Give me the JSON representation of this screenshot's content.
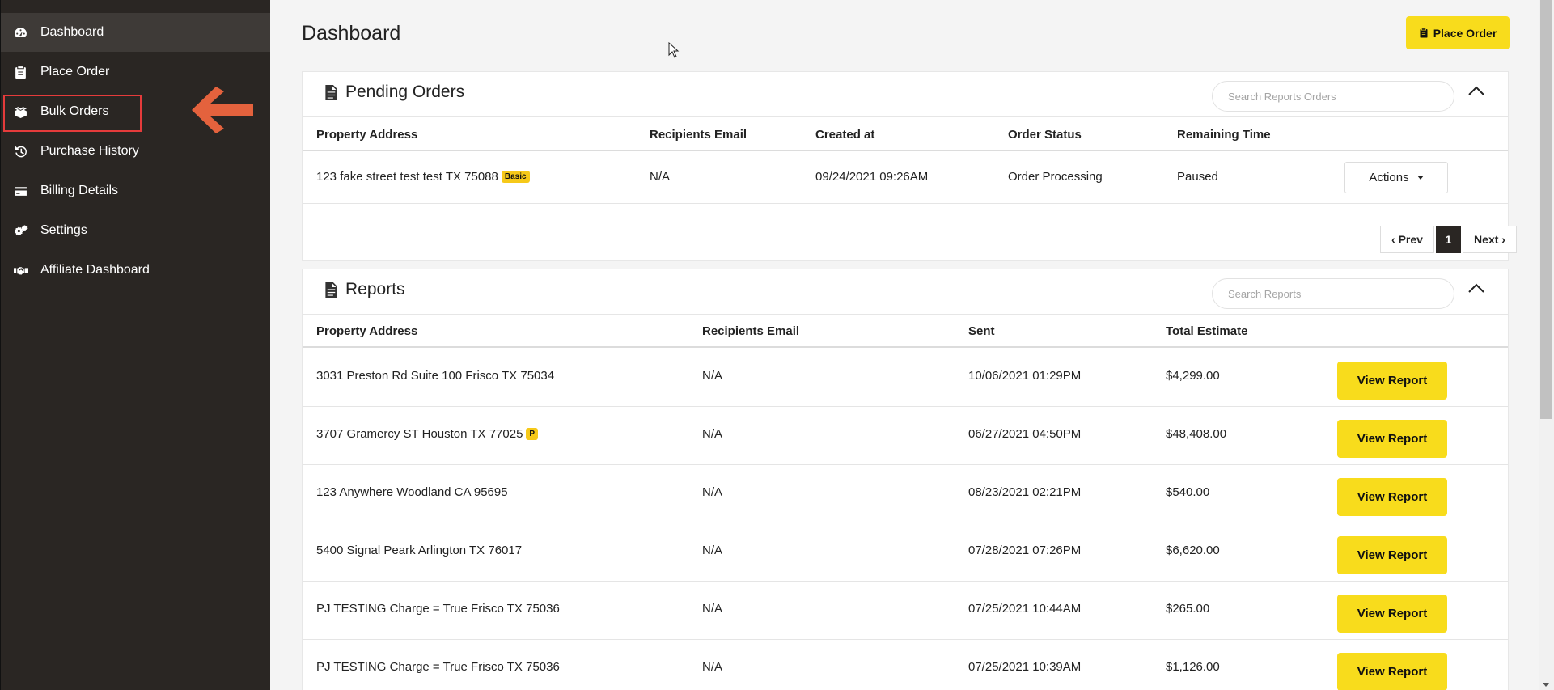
{
  "sidebar": {
    "items": [
      {
        "label": "Dashboard",
        "icon": "dashboard-icon"
      },
      {
        "label": "Place Order",
        "icon": "clipboard-icon"
      },
      {
        "label": "Bulk Orders",
        "icon": "boxes-icon"
      },
      {
        "label": "Purchase History",
        "icon": "history-icon"
      },
      {
        "label": "Billing Details",
        "icon": "credit-card-icon"
      },
      {
        "label": "Settings",
        "icon": "gears-icon"
      },
      {
        "label": "Affiliate Dashboard",
        "icon": "handshake-icon"
      }
    ],
    "active_index": 0,
    "highlight_color": "#e53b3b",
    "arrow_color": "#e4623d"
  },
  "header": {
    "title": "Dashboard",
    "place_order_label": "Place Order"
  },
  "pending": {
    "title": "Pending Orders",
    "search_placeholder": "Search Reports Orders",
    "columns": [
      "Property Address",
      "Recipients Email",
      "Created at",
      "Order Status",
      "Remaining Time"
    ],
    "rows": [
      {
        "address": "123 fake street test test TX 75088",
        "badge": "Basic",
        "email": "N/A",
        "created": "09/24/2021 09:26AM",
        "status": "Order Processing",
        "remaining": "Paused",
        "action": "Actions"
      }
    ],
    "pager": {
      "prev": "‹ Prev",
      "page": "1",
      "next": "Next ›"
    }
  },
  "reports": {
    "title": "Reports",
    "search_placeholder": "Search Reports",
    "columns": [
      "Property Address",
      "Recipients Email",
      "Sent",
      "Total Estimate"
    ],
    "button_label": "View Report",
    "rows": [
      {
        "address": "3031 Preston Rd Suite 100 Frisco TX 75034",
        "badge": "",
        "email": "N/A",
        "sent": "10/06/2021 01:29PM",
        "total": "$4,299.00"
      },
      {
        "address": "3707 Gramercy ST Houston TX 77025",
        "badge": "P",
        "email": "N/A",
        "sent": "06/27/2021 04:50PM",
        "total": "$48,408.00"
      },
      {
        "address": "123 Anywhere Woodland CA 95695",
        "badge": "",
        "email": "N/A",
        "sent": "08/23/2021 02:21PM",
        "total": "$540.00"
      },
      {
        "address": "5400 Signal Peark Arlington TX 76017",
        "badge": "",
        "email": "N/A",
        "sent": "07/28/2021 07:26PM",
        "total": "$6,620.00"
      },
      {
        "address": "PJ TESTING Charge = True Frisco TX 75036",
        "badge": "",
        "email": "N/A",
        "sent": "07/25/2021 10:44AM",
        "total": "$265.00"
      },
      {
        "address": "PJ TESTING Charge = True Frisco TX 75036",
        "badge": "",
        "email": "N/A",
        "sent": "07/25/2021 10:39AM",
        "total": "$1,126.00"
      }
    ]
  },
  "colors": {
    "sidebar_bg": "#2a2623",
    "accent_yellow": "#f8dc1c",
    "badge_yellow": "#f6c919"
  }
}
